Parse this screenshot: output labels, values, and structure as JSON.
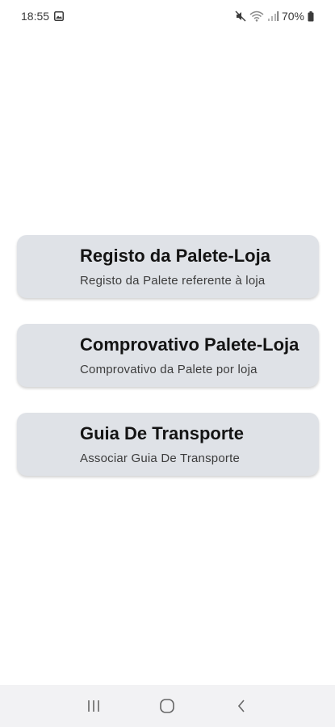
{
  "status_bar": {
    "time": "18:55",
    "battery": "70%"
  },
  "menu": [
    {
      "title": "Registo da Palete-Loja",
      "subtitle": "Registo da Palete referente à loja"
    },
    {
      "title": "Comprovativo Palete-Loja",
      "subtitle": "Comprovativo da Palete por loja"
    },
    {
      "title": "Guia De Transporte",
      "subtitle": "Associar Guia De Transporte"
    }
  ],
  "colors": {
    "card_background": "#dfe2e7",
    "nav_background": "#f2f2f4"
  },
  "nav_bar": {
    "icons": [
      "recent-apps-icon",
      "home-icon",
      "back-icon"
    ]
  }
}
